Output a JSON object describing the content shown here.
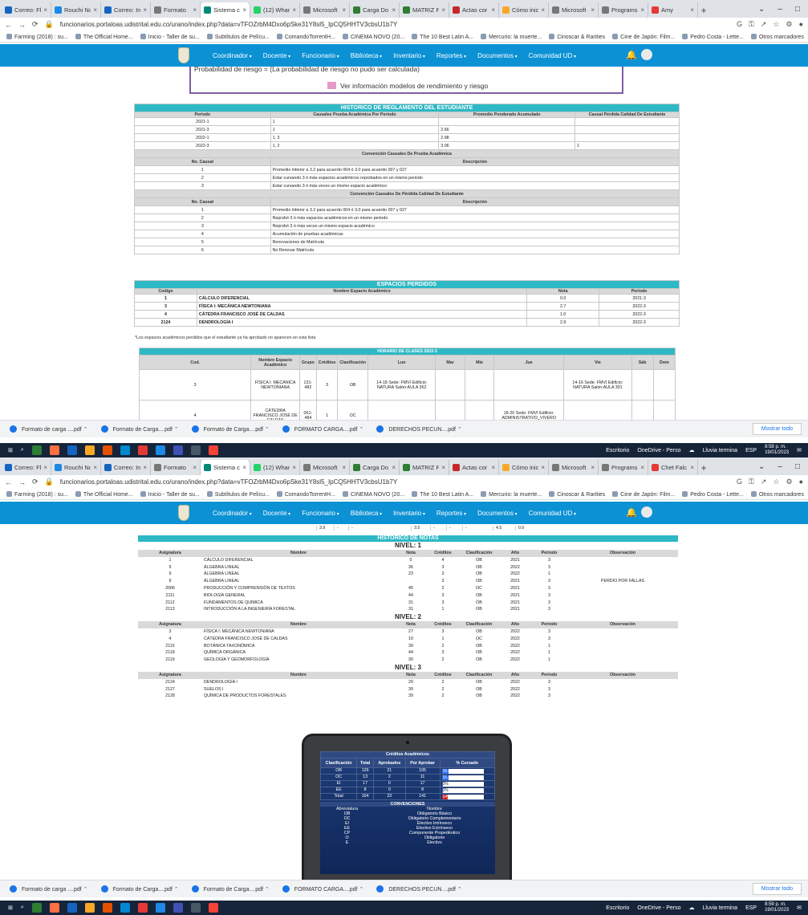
{
  "browser": {
    "tabs": [
      {
        "label": "Correo: Fl",
        "color": "#1565c0"
      },
      {
        "label": "Rouchi Nc",
        "color": "#1e88e5"
      },
      {
        "label": "Correo: In",
        "color": "#1565c0"
      },
      {
        "label": "Formato",
        "color": "#777777"
      },
      {
        "label": "Sistema c",
        "color": "#00897b"
      },
      {
        "label": "(12) Whar",
        "color": "#25d366"
      },
      {
        "label": "Microsoft",
        "color": "#777777"
      },
      {
        "label": "Carga Do",
        "color": "#2e7d32"
      },
      {
        "label": "MATRIZ P",
        "color": "#2e7d32"
      },
      {
        "label": "Actas cor",
        "color": "#c62828"
      },
      {
        "label": "Cómo inic",
        "color": "#f9a825"
      },
      {
        "label": "Microsoft",
        "color": "#777777"
      },
      {
        "label": "Programs",
        "color": "#777777"
      },
      {
        "label": "Amy",
        "color": "#e53935"
      }
    ],
    "tabs2": [
      {
        "label": "Correo: Fl",
        "color": "#1565c0"
      },
      {
        "label": "Rouchi Nc",
        "color": "#1e88e5"
      },
      {
        "label": "Correo: In",
        "color": "#1565c0"
      },
      {
        "label": "Formato",
        "color": "#777777"
      },
      {
        "label": "Sistema c",
        "color": "#00897b"
      },
      {
        "label": "(12) Whar",
        "color": "#25d366"
      },
      {
        "label": "Microsoft",
        "color": "#777777"
      },
      {
        "label": "Carga Do",
        "color": "#2e7d32"
      },
      {
        "label": "MATRIZ P",
        "color": "#2e7d32"
      },
      {
        "label": "Actas cor",
        "color": "#c62828"
      },
      {
        "label": "Cómo inic",
        "color": "#f9a825"
      },
      {
        "label": "Microsoft",
        "color": "#777777"
      },
      {
        "label": "Programs",
        "color": "#777777"
      },
      {
        "label": "Chet Falc",
        "color": "#e53935"
      }
    ],
    "url": "funcionarios.portaloas.udistrital.edu.co/urano/index.php?data=vTFOZrbM4Dxo6pSke31Y8sl5_IpCQ5HHTV3cbsU1b7Y",
    "bookmarks": [
      "Farming (2018) : su...",
      "The Official Home...",
      "Inicio - Taller de su...",
      "Subtítulos de Pelícu...",
      "ComandoTorrentH...",
      "CINEMA NOVO (20...",
      "The 10 Best Latin A...",
      "Mercurio: la muerte...",
      "Cinoscar & Rarities",
      "Cine de Japón: Film...",
      "Pedro Costa - Lette..."
    ],
    "other_bookmarks": "Otros marcadores"
  },
  "nav": {
    "items": [
      "Coordinador",
      "Docente",
      "Funcionario",
      "Biblioteca",
      "Inventario",
      "Reportes",
      "Documentos",
      "Comunidad UD"
    ]
  },
  "prob": {
    "text": "Probabilidad de riesgo = (La probabilidad de riesgo no pudo ser calculada)",
    "link": "Ver información modelos de rendimiento y riesgo"
  },
  "historico_reglamento": {
    "title": "HISTORICO DE REGLAMENTO DEL ESTUDIANTE",
    "columns": [
      "Periodo",
      "Causales Prueba Académica Por Periodo",
      "Promedio Ponderado Acumulado",
      "Causal Pérdida Calidad De Estudiante"
    ],
    "rows": [
      [
        "2021-1",
        "1",
        "",
        ""
      ],
      [
        "2021-3",
        "1",
        "2.66",
        ""
      ],
      [
        "2022-1",
        "1, 3",
        "2.98",
        ""
      ],
      [
        "2022-3",
        "1, 2",
        "3.06",
        "1"
      ]
    ],
    "conv1_title": "Convención Causales De Prueba Académica",
    "conv1_cols": [
      "No. Causal",
      "Descripción"
    ],
    "conv1_rows": [
      [
        "1",
        "Promedio inferior a 3.2 para acuerdo 004 ó 3.0 para acuerdo 007 y 027"
      ],
      [
        "2",
        "Estar cursando 3 ó más espacios académicos reprobados en un mismo periodo"
      ],
      [
        "3",
        "Estar cursando 3 ó más veces un mismo espacio académico"
      ]
    ],
    "conv2_title": "Convención Causales De Pérdida Calidad De Estudiante",
    "conv2_cols": [
      "No. Causal",
      "Descripción"
    ],
    "conv2_rows": [
      [
        "1",
        "Promedio inferior a 3.2 para acuerdo 004 ó 3.0 para acuerdo 007 y 027"
      ],
      [
        "2",
        "Reprobó 3 ó más espacios académicos en un mismo periodo"
      ],
      [
        "3",
        "Reprobó 3 ó más veces un mismo espacio académico"
      ],
      [
        "4",
        "Acumulación de pruebas académicas"
      ],
      [
        "5",
        "Renovaciones de Matrícula"
      ],
      [
        "6",
        "No Renovar Matrícula"
      ]
    ]
  },
  "espacios": {
    "title": "ESPACIOS PERDIDOS",
    "columns": [
      "Codigo",
      "Nombre Espacio Académico",
      "Nota",
      "Periodo"
    ],
    "rows": [
      [
        "1",
        "CÁLCULO DIFERENCIAL",
        "0.0",
        "2021-3"
      ],
      [
        "3",
        "FÍSICA I: MECÁNICA NEWTONIANA",
        "2.7",
        "2022-3"
      ],
      [
        "4",
        "CÁTEDRA FRANCISCO JOSÉ DE CALDAS",
        "1.0",
        "2022-3"
      ],
      [
        "2124",
        "DENDROLOGÍA I",
        "2.9",
        "2022-3"
      ]
    ],
    "note": "*Los espacios académicos perdidos que el estudiante ya ha aprobado no aparecen en esta lista"
  },
  "horario": {
    "title": "HORARIO DE CLASES 2022-3",
    "columns": [
      "Cod.",
      "Nombre Espacio Académico",
      "Grupo",
      "Créditos",
      "Clasificación",
      "Lun",
      "Mar",
      "Mie",
      "Jue",
      "Vie",
      "Sáb",
      "Dom"
    ],
    "rows": [
      [
        "3",
        "FÍSICA I: MECÁNICA NEWTONIANA",
        "131-482",
        "3",
        "OB",
        "14-18 Sede: FMVI Edificio: NATURA Salón:AULA 362",
        "",
        "",
        "",
        "14-16 Sede: FMVI Edificio: NATURA Salón:AULA 301",
        "",
        ""
      ],
      [
        "4",
        "CÁTEDRA FRANCISCO JOSÉ DE CALDAS",
        "061-484",
        "1",
        "OC",
        "",
        "",
        "",
        "18-20 Sede: FMVI Edificio: ADMINISTRATIVO_VIVERO",
        "",
        "",
        ""
      ]
    ]
  },
  "downloads": [
    "Formato de carga ....pdf",
    "Formato de Carga....pdf",
    "Formato de Carga....pdf",
    "FORMATO CARGA....pdf",
    "DERECHOS PECUN....pdf"
  ],
  "downloads_more": "Mostrar todo",
  "taskbar": {
    "desktop": "Escritorio",
    "onedrive": "OneDrive - Perso",
    "weather": "Lluvia termina",
    "lang": "ESP",
    "time1": "8:58 p. m.",
    "time2": "8:59 p. m.",
    "date": "19/01/2023"
  },
  "historico_notas": {
    "prev_row": [
      "3.9",
      "-",
      "-",
      "3.5",
      "-",
      "-",
      "-",
      "4.5",
      "0.0"
    ],
    "title": "HISTORICO DE NOTAS",
    "columns": [
      "Asignatura",
      "Nombre",
      "Nota",
      "Créditos",
      "Clasificación",
      "Año",
      "Periodo",
      "Observación"
    ],
    "levels": [
      {
        "label": "NIVEL: 1",
        "rows": [
          [
            "1",
            "CÁLCULO DIFERENCIAL",
            "0",
            "4",
            "OB",
            "2021",
            "3",
            ""
          ],
          [
            "9",
            "ÁLGEBRA LINEAL",
            "36",
            "3",
            "OB",
            "2022",
            "3",
            ""
          ],
          [
            "9",
            "ÁLGEBRA LINEAL",
            "23",
            "3",
            "OB",
            "2022",
            "1",
            ""
          ],
          [
            "9",
            "ÁLGEBRA LINEAL",
            "",
            "3",
            "OB",
            "2021",
            "3",
            "PERDIO POR FALLAS"
          ],
          [
            "2006",
            "PRODUCCIÓN Y COMPRENSIÓN DE TEXTOS",
            "45",
            "2",
            "OC",
            "2021",
            "3",
            ""
          ],
          [
            "2111",
            "BIOLOGÍA GENERAL",
            "44",
            "3",
            "OB",
            "2021",
            "3",
            ""
          ],
          [
            "2112",
            "FUNDAMENTOS DE QUÍMICA",
            "31",
            "3",
            "OB",
            "2021",
            "3",
            ""
          ],
          [
            "2113",
            "INTRODUCCIÓN A LA INGENIERÍA FORESTAL",
            "31",
            "1",
            "OB",
            "2021",
            "3",
            ""
          ]
        ]
      },
      {
        "label": "NIVEL: 2",
        "rows": [
          [
            "3",
            "FÍSICA I: MECÁNICA NEWTONIANA",
            "27",
            "3",
            "OB",
            "2022",
            "3",
            ""
          ],
          [
            "4",
            "CÁTEDRA FRANCISCO JOSÉ DE CALDAS",
            "10",
            "1",
            "OC",
            "2022",
            "3",
            ""
          ],
          [
            "2115",
            "BOTÁNICA TAXONÓMICA",
            "39",
            "2",
            "OB",
            "2022",
            "1",
            ""
          ],
          [
            "2118",
            "QUÍMICA ORGÁNICA",
            "44",
            "3",
            "OB",
            "2022",
            "1",
            ""
          ],
          [
            "2119",
            "GEOLOGÍA Y GEOMORFOLOGÍA",
            "30",
            "2",
            "OB",
            "2022",
            "1",
            ""
          ]
        ]
      },
      {
        "label": "NIVEL: 3",
        "rows": [
          [
            "2124",
            "DENDROLOGÍA I",
            "29",
            "2",
            "OB",
            "2022",
            "3",
            ""
          ],
          [
            "2127",
            "SUELOS I",
            "30",
            "2",
            "OB",
            "2022",
            "3",
            ""
          ],
          [
            "2128",
            "QUÍMICA DE PRODUCTOS FORESTALES",
            "39",
            "2",
            "OB",
            "2022",
            "3",
            ""
          ]
        ]
      }
    ]
  },
  "creditos": {
    "title": "Créditos Académicos",
    "columns": [
      "Clasificación",
      "Total",
      "Aprobados",
      "Por Aprobar",
      "% Cursado"
    ],
    "rows": [
      {
        "cls": "OB",
        "total": "126",
        "aprob": "21",
        "por": "105",
        "pct": "16.67%",
        "frac": 0.1667
      },
      {
        "cls": "OC",
        "total": "13",
        "aprob": "2",
        "por": "11",
        "pct": "15.4%",
        "frac": 0.154
      },
      {
        "cls": "EI",
        "total": "17",
        "aprob": "0",
        "por": "17",
        "pct": "0%",
        "frac": 0
      },
      {
        "cls": "EE",
        "total": "8",
        "aprob": "0",
        "por": "8",
        "pct": "0%",
        "frac": 0
      },
      {
        "cls": "Total",
        "total": "164",
        "aprob": "23",
        "por": "141",
        "pct": "14%",
        "frac": 0.14
      }
    ],
    "conv_title": "CONVENCIONES",
    "conv_cols": [
      "Abreviatura",
      "Nombre"
    ],
    "conv_rows": [
      [
        "OB",
        "Obligatorio Básico"
      ],
      [
        "OC",
        "Obligatorio Complementario"
      ],
      [
        "EI",
        "Electivo Intrínseco"
      ],
      [
        "EE",
        "Electivo Extrínseco"
      ],
      [
        "CP",
        "Componente Propedéutico"
      ],
      [
        "O",
        "Obligatorio"
      ],
      [
        "E",
        "Electivo"
      ]
    ]
  }
}
